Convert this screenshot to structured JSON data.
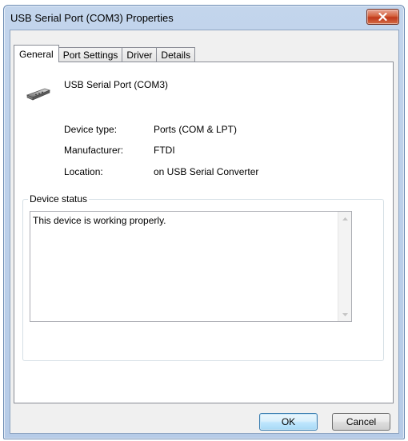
{
  "window": {
    "title": "USB Serial Port (COM3) Properties"
  },
  "tabs": [
    {
      "label": "General"
    },
    {
      "label": "Port Settings"
    },
    {
      "label": "Driver"
    },
    {
      "label": "Details"
    }
  ],
  "general": {
    "device_name": "USB Serial Port (COM3)",
    "device_icon": "serial-port-connector-icon",
    "properties": [
      {
        "label": "Device type:",
        "value": "Ports (COM & LPT)"
      },
      {
        "label": "Manufacturer:",
        "value": "FTDI"
      },
      {
        "label": "Location:",
        "value": "on USB Serial Converter"
      }
    ],
    "status_group_label": "Device status",
    "status_text": "This device is working properly."
  },
  "buttons": {
    "ok": "OK",
    "cancel": "Cancel"
  },
  "colors": {
    "close_button": "#c0391b",
    "window_frame": "#bcd0ea",
    "default_button": "#bee6fd"
  }
}
